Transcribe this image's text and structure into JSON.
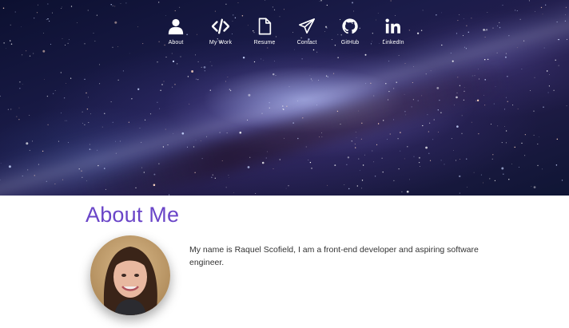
{
  "nav": {
    "items": [
      {
        "label": "About",
        "icon": "user-icon"
      },
      {
        "label": "My Work",
        "icon": "code-icon"
      },
      {
        "label": "Resume",
        "icon": "file-icon"
      },
      {
        "label": "Contact",
        "icon": "paper-plane-icon"
      },
      {
        "label": "GitHub",
        "icon": "github-icon"
      },
      {
        "label": "LinkedIn",
        "icon": "linkedin-icon"
      }
    ]
  },
  "about": {
    "title": "About Me",
    "bio": "My name is Raquel Scofield, I am a front-end developer and aspiring software engineer."
  },
  "colors": {
    "accent": "#6a45c8",
    "body_text": "#333333"
  }
}
